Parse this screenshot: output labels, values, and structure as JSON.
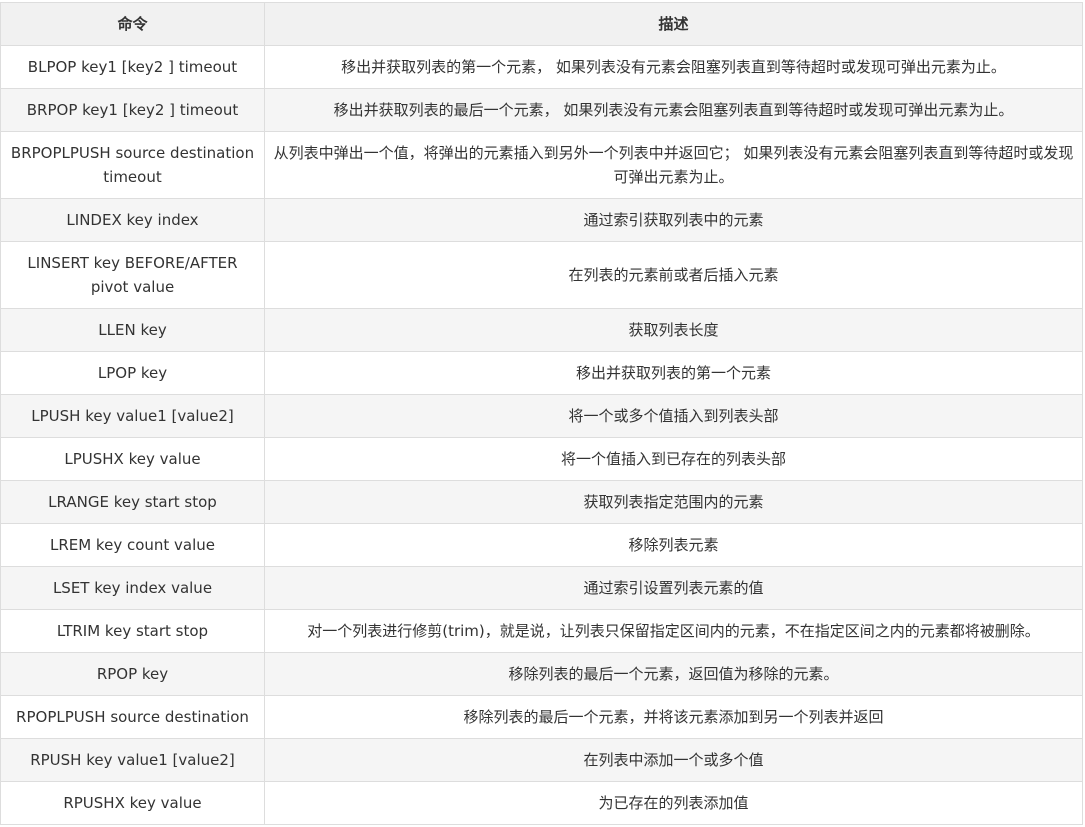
{
  "table": {
    "headers": [
      "命令",
      "描述"
    ],
    "rows": [
      {
        "command": "BLPOP key1 [key2 ] timeout",
        "description": "移出并获取列表的第一个元素， 如果列表没有元素会阻塞列表直到等待超时或发现可弹出元素为止。"
      },
      {
        "command": "BRPOP key1 [key2 ] timeout",
        "description": "移出并获取列表的最后一个元素， 如果列表没有元素会阻塞列表直到等待超时或发现可弹出元素为止。"
      },
      {
        "command": "BRPOPLPUSH source destination timeout",
        "description": "从列表中弹出一个值，将弹出的元素插入到另外一个列表中并返回它； 如果列表没有元素会阻塞列表直到等待超时或发现可弹出元素为止。"
      },
      {
        "command": "LINDEX key index",
        "description": "通过索引获取列表中的元素"
      },
      {
        "command": "LINSERT key BEFORE/AFTER pivot value",
        "description": "在列表的元素前或者后插入元素"
      },
      {
        "command": "LLEN key",
        "description": "获取列表长度"
      },
      {
        "command": "LPOP key",
        "description": "移出并获取列表的第一个元素"
      },
      {
        "command": "LPUSH key value1 [value2]",
        "description": "将一个或多个值插入到列表头部"
      },
      {
        "command": "LPUSHX key value",
        "description": "将一个值插入到已存在的列表头部"
      },
      {
        "command": "LRANGE key start stop",
        "description": "获取列表指定范围内的元素"
      },
      {
        "command": "LREM key count value",
        "description": "移除列表元素"
      },
      {
        "command": "LSET key index value",
        "description": "通过索引设置列表元素的值"
      },
      {
        "command": "LTRIM key start stop",
        "description": "对一个列表进行修剪(trim)，就是说，让列表只保留指定区间内的元素，不在指定区间之内的元素都将被删除。"
      },
      {
        "command": "RPOP key",
        "description": "移除列表的最后一个元素，返回值为移除的元素。"
      },
      {
        "command": "RPOPLPUSH source destination",
        "description": "移除列表的最后一个元素，并将该元素添加到另一个列表并返回"
      },
      {
        "command": "RPUSH key value1 [value2]",
        "description": "在列表中添加一个或多个值"
      },
      {
        "command": "RPUSHX key value",
        "description": "为已存在的列表添加值"
      }
    ]
  }
}
